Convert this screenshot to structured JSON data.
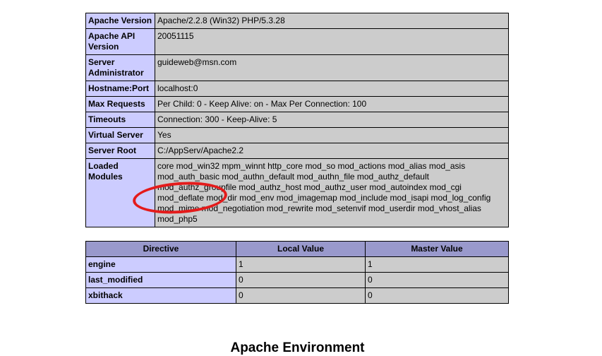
{
  "apache_info": {
    "rows": [
      {
        "key": "Apache Version",
        "value": "Apache/2.2.8 (Win32) PHP/5.3.28"
      },
      {
        "key": "Apache API Version",
        "value": "20051115"
      },
      {
        "key": "Server Administrator",
        "value": "guideweb@msn.com"
      },
      {
        "key": "Hostname:Port",
        "value": "localhost:0"
      },
      {
        "key": "Max Requests",
        "value": "Per Child: 0 - Keep Alive: on - Max Per Connection: 100"
      },
      {
        "key": "Timeouts",
        "value": "Connection: 300 - Keep-Alive: 5"
      },
      {
        "key": "Virtual Server",
        "value": "Yes"
      },
      {
        "key": "Server Root",
        "value": "C:/AppServ/Apache2.2"
      },
      {
        "key": "Loaded Modules",
        "value": "core mod_win32 mpm_winnt http_core mod_so mod_actions mod_alias mod_asis mod_auth_basic mod_authn_default mod_authn_file mod_authz_default mod_authz_groupfile mod_authz_host mod_authz_user mod_autoindex mod_cgi mod_deflate mod_dir mod_env mod_imagemap mod_include mod_isapi mod_log_config mod_mime mod_negotiation mod_rewrite mod_setenvif mod_userdir mod_vhost_alias mod_php5"
      }
    ]
  },
  "directives": {
    "headers": [
      "Directive",
      "Local Value",
      "Master Value"
    ],
    "rows": [
      {
        "directive": "engine",
        "local": "1",
        "master": "1"
      },
      {
        "directive": "last_modified",
        "local": "0",
        "master": "0"
      },
      {
        "directive": "xbithack",
        "local": "0",
        "master": "0"
      }
    ]
  },
  "next_section_title": "Apache Environment",
  "colors": {
    "key_cell": "#ccccff",
    "value_cell": "#cccccc",
    "header_cell": "#9999cc",
    "annotation": "#e41b1b"
  }
}
